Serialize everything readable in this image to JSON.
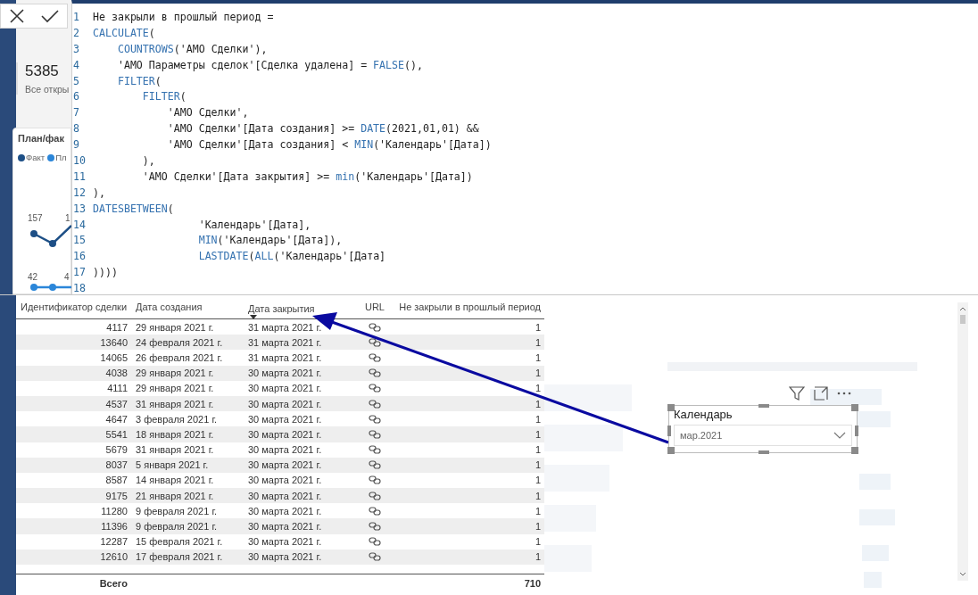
{
  "code_editor": {
    "lines": [
      {
        "number": "1",
        "tokens": [
          {
            "text": "Не закрыли в прошлый период =",
            "kind": "plain"
          }
        ]
      },
      {
        "number": "2",
        "tokens": [
          {
            "text": "CALCULATE",
            "kind": "fn"
          },
          {
            "text": "(",
            "kind": "plain"
          }
        ]
      },
      {
        "number": "3",
        "tokens": [
          {
            "text": "    COUNTROWS",
            "kind": "fn"
          },
          {
            "text": "('АМО Сделки'),",
            "kind": "plain"
          }
        ]
      },
      {
        "number": "4",
        "tokens": [
          {
            "text": "    'АМО Параметры сделок'[Сделка удалена] = ",
            "kind": "plain"
          },
          {
            "text": "FALSE",
            "kind": "fn"
          },
          {
            "text": "(),",
            "kind": "plain"
          }
        ]
      },
      {
        "number": "5",
        "tokens": [
          {
            "text": "    FILTER",
            "kind": "fn"
          },
          {
            "text": "(",
            "kind": "plain"
          }
        ]
      },
      {
        "number": "6",
        "tokens": [
          {
            "text": "        FILTER",
            "kind": "fn"
          },
          {
            "text": "(",
            "kind": "plain"
          }
        ]
      },
      {
        "number": "7",
        "tokens": [
          {
            "text": "            'АМО Сделки',",
            "kind": "plain"
          }
        ]
      },
      {
        "number": "8",
        "tokens": [
          {
            "text": "            'АМО Сделки'[Дата создания] >= ",
            "kind": "plain"
          },
          {
            "text": "DATE",
            "kind": "fn"
          },
          {
            "text": "(2021,01,01) &&",
            "kind": "plain"
          }
        ]
      },
      {
        "number": "9",
        "tokens": [
          {
            "text": "            'АМО Сделки'[Дата создания] < ",
            "kind": "plain"
          },
          {
            "text": "MIN",
            "kind": "fn"
          },
          {
            "text": "('Календарь'[Дата])",
            "kind": "plain"
          }
        ]
      },
      {
        "number": "10",
        "tokens": [
          {
            "text": "        ),",
            "kind": "plain"
          }
        ]
      },
      {
        "number": "11",
        "tokens": [
          {
            "text": "        'АМО Сделки'[Дата закрытия] >= ",
            "kind": "plain"
          },
          {
            "text": "min",
            "kind": "fn"
          },
          {
            "text": "('Календарь'[Дата])",
            "kind": "plain"
          }
        ]
      },
      {
        "number": "12",
        "tokens": [
          {
            "text": "),",
            "kind": "plain"
          }
        ]
      },
      {
        "number": "13",
        "tokens": [
          {
            "text": "DATESBETWEEN",
            "kind": "fn"
          },
          {
            "text": "(",
            "kind": "plain"
          }
        ]
      },
      {
        "number": "14",
        "tokens": [
          {
            "text": "                 'Календарь'[Дата],",
            "kind": "plain"
          }
        ]
      },
      {
        "number": "15",
        "tokens": [
          {
            "text": "                 MIN",
            "kind": "fn"
          },
          {
            "text": "('Календарь'[Дата]),",
            "kind": "plain"
          }
        ]
      },
      {
        "number": "16",
        "tokens": [
          {
            "text": "                 LASTDATE",
            "kind": "fn"
          },
          {
            "text": "(",
            "kind": "plain"
          },
          {
            "text": "ALL",
            "kind": "fn"
          },
          {
            "text": "('Календарь'[Дата]",
            "kind": "plain"
          }
        ]
      },
      {
        "number": "17",
        "tokens": [
          {
            "text": "))))",
            "kind": "plain"
          }
        ]
      },
      {
        "number": "18"
      }
    ]
  },
  "kpi_card": {
    "value": "5385",
    "label": "Все откры"
  },
  "chart_card": {
    "title": "План/фак",
    "legend": [
      {
        "label": "Факт",
        "color": "#1d4f86"
      },
      {
        "label": "Пл",
        "color": "#2b86d9"
      }
    ],
    "data_labels": [
      "157",
      "1",
      "42",
      "4"
    ]
  },
  "table": {
    "columns": [
      {
        "label": "Идентификатор сделки",
        "sorted": false
      },
      {
        "label": "Дата создания",
        "sorted": false
      },
      {
        "label": "Дата закрытия",
        "sorted": true
      },
      {
        "label": "URL",
        "sorted": false
      },
      {
        "label": "Не закрыли в прошлый период",
        "sorted": false
      }
    ],
    "rows": [
      [
        "4117",
        "29 января 2021 г.",
        "31 марта 2021 г.",
        "1"
      ],
      [
        "13640",
        "24 февраля 2021 г.",
        "31 марта 2021 г.",
        "1"
      ],
      [
        "14065",
        "26 февраля 2021 г.",
        "31 марта 2021 г.",
        "1"
      ],
      [
        "4038",
        "29 января 2021 г.",
        "30 марта 2021 г.",
        "1"
      ],
      [
        "4111",
        "29 января 2021 г.",
        "30 марта 2021 г.",
        "1"
      ],
      [
        "4537",
        "31 января 2021 г.",
        "30 марта 2021 г.",
        "1"
      ],
      [
        "4647",
        "3 февраля 2021 г.",
        "30 марта 2021 г.",
        "1"
      ],
      [
        "5541",
        "18 января 2021 г.",
        "30 марта 2021 г.",
        "1"
      ],
      [
        "5679",
        "31 января 2021 г.",
        "30 марта 2021 г.",
        "1"
      ],
      [
        "8037",
        "5 января 2021 г.",
        "30 марта 2021 г.",
        "1"
      ],
      [
        "8587",
        "14 января 2021 г.",
        "30 марта 2021 г.",
        "1"
      ],
      [
        "9175",
        "21 января 2021 г.",
        "30 марта 2021 г.",
        "1"
      ],
      [
        "11280",
        "9 февраля 2021 г.",
        "30 марта 2021 г.",
        "1"
      ],
      [
        "11396",
        "9 февраля 2021 г.",
        "30 марта 2021 г.",
        "1"
      ],
      [
        "12287",
        "15 февраля 2021 г.",
        "30 марта 2021 г.",
        "1"
      ],
      [
        "12610",
        "17 февраля 2021 г.",
        "30 марта 2021 г.",
        "1"
      ]
    ],
    "total": {
      "label": "Всего",
      "value": "710"
    }
  },
  "slicer": {
    "title": "Календарь",
    "value": "мар.2021"
  }
}
